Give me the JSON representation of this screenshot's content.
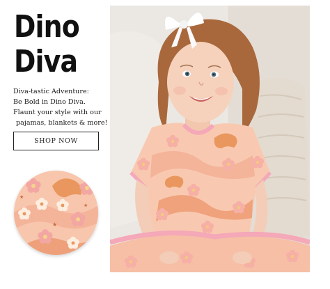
{
  "promo": {
    "title_line1": "Dino",
    "title_line2": "Diva",
    "description": [
      "Diva-tastic Adventure:",
      "Be Bold in Dino Diva.",
      "Flaunt your style with our",
      "pajamas, blankets & more!"
    ],
    "cta_label": "SHOP NOW"
  },
  "colors": {
    "text": "#111111",
    "background": "#ffffff",
    "fabric_base": "#f7c6ad",
    "fabric_pink": "#f3a7a3",
    "fabric_orange": "#e9975e",
    "fabric_cream": "#fdeee0",
    "trim_pink": "#f4a8b8"
  },
  "icons": {
    "swatch": "dino-diva-fabric-swatch",
    "photo": "toddler-in-dino-diva-dress-photo"
  }
}
